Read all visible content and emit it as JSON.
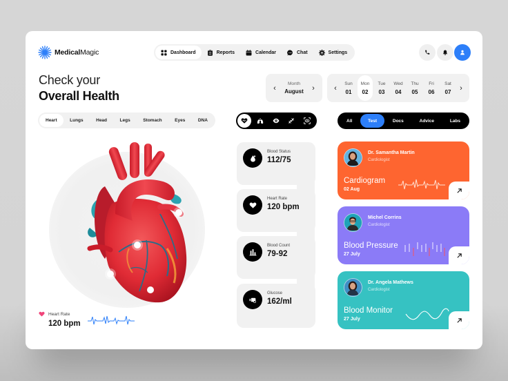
{
  "app": {
    "brand_bold": "Medical",
    "brand_light": "Magic"
  },
  "nav": {
    "items": [
      {
        "label": "Dashboard",
        "icon": "grid-icon",
        "active": true
      },
      {
        "label": "Reports",
        "icon": "clipboard-icon"
      },
      {
        "label": "Calendar",
        "icon": "calendar-icon"
      },
      {
        "label": "Chat",
        "icon": "chat-icon"
      },
      {
        "label": "Settings",
        "icon": "gear-icon"
      }
    ]
  },
  "header_actions": [
    "phone-icon",
    "bell-icon",
    "user-icon"
  ],
  "page": {
    "title_line1": "Check your",
    "title_line2": "Overall Health"
  },
  "month_picker": {
    "label": "Month",
    "value": "August"
  },
  "week": {
    "days": [
      {
        "name": "Sun",
        "num": "01"
      },
      {
        "name": "Mon",
        "num": "02",
        "active": true
      },
      {
        "name": "Tue",
        "num": "03"
      },
      {
        "name": "Wed",
        "num": "04"
      },
      {
        "name": "Thu",
        "num": "05"
      },
      {
        "name": "Fri",
        "num": "06"
      },
      {
        "name": "Sat",
        "num": "07"
      }
    ]
  },
  "organ_tabs": [
    "Heart",
    "Lungs",
    "Head",
    "Legs",
    "Stomach",
    "Eyes",
    "DNA"
  ],
  "organ_active": "Heart",
  "icon_tabs": [
    "heart-icon",
    "lungs-icon",
    "eye-icon",
    "dna-icon",
    "scan-icon"
  ],
  "filter_tabs": [
    "All",
    "Test",
    "Docs",
    "Advice",
    "Labs"
  ],
  "filter_active": "Test",
  "heart_rate_widget": {
    "label": "Heart Rate",
    "value": "120 bpm"
  },
  "stats": [
    {
      "label": "Blood Status",
      "value": "112/75",
      "icon": "blood-drop-icon"
    },
    {
      "label": "Heart Rate",
      "value": "120 bpm",
      "icon": "heart-icon"
    },
    {
      "label": "Blood Count",
      "value": "79-92",
      "icon": "bar-chart-icon"
    },
    {
      "label": "Glucose",
      "value": "162/ml",
      "icon": "glucose-meter-icon"
    }
  ],
  "doctors": [
    {
      "name": "Dr. Samantha Martin",
      "role": "Cardiologist",
      "test": "Cardiogram",
      "date": "02 Aug",
      "color": "#fe6530"
    },
    {
      "name": "Michel Corrins",
      "role": "Cardiologist",
      "test": "Blood Pressure",
      "date": "27 July",
      "color": "#8b7bf7"
    },
    {
      "name": "Dr. Angela Mathews",
      "role": "Cardiologist",
      "test": "Blood Monitor",
      "date": "27 July",
      "color": "#36c2c2"
    }
  ],
  "colors": {
    "accent_blue": "#2d7ff9",
    "heart_pink": "#f0457a",
    "wave_blue": "#2d7ff9"
  }
}
